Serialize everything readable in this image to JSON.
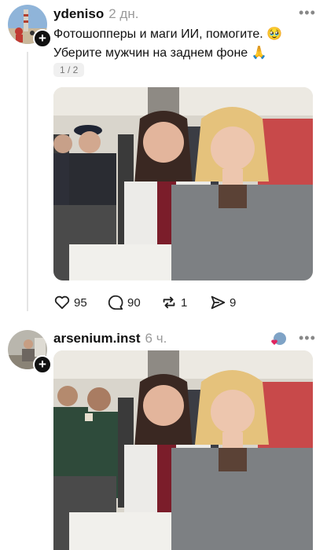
{
  "post1": {
    "username": "ydeniso",
    "time": "2 дн.",
    "text_line1": "Фотошопперы и маги ИИ, помогите. 🥹",
    "text_line2": "Уберите мужчин на заднем фоне 🙏",
    "image_counter": "1 / 2",
    "likes": "95",
    "comments": "90",
    "reposts": "1",
    "shares": "9"
  },
  "post2": {
    "username": "arsenium.inst",
    "time": "6 ч."
  },
  "ui": {
    "more_icon": "more-horizontal-icon",
    "plus_icon": "plus-icon",
    "accent_dark": "#111111",
    "muted": "#9a9a9a"
  }
}
